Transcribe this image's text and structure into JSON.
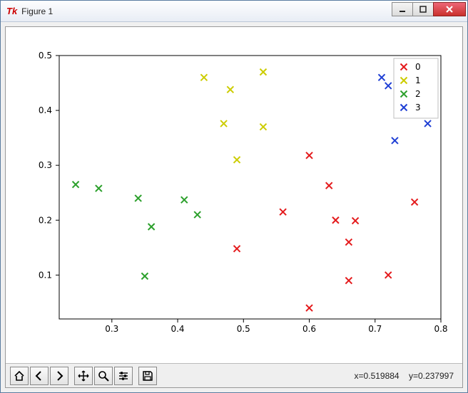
{
  "window": {
    "title": "Figure 1",
    "icon_label": "Tk"
  },
  "toolbar": {
    "home": "Home",
    "back": "Back",
    "forward": "Forward",
    "pan": "Pan",
    "zoom": "Zoom",
    "configure": "Configure subplots",
    "save": "Save"
  },
  "status": {
    "coord_text": "x=0.519884    y=0.237997"
  },
  "legend": {
    "title": "",
    "items": [
      {
        "label": "0",
        "color": "#e41a1c"
      },
      {
        "label": "1",
        "color": "#cccc00"
      },
      {
        "label": "2",
        "color": "#2ca02c"
      },
      {
        "label": "3",
        "color": "#1f3fd4"
      }
    ]
  },
  "chart_data": {
    "type": "scatter",
    "xlabel": "",
    "ylabel": "",
    "title": "",
    "xlim": [
      0.22,
      0.8
    ],
    "ylim": [
      0.02,
      0.5
    ],
    "xticks": [
      0.3,
      0.4,
      0.5,
      0.6,
      0.7,
      0.8
    ],
    "yticks": [
      0.1,
      0.2,
      0.3,
      0.4,
      0.5
    ],
    "marker": "x",
    "series": [
      {
        "name": "0",
        "color": "#e41a1c",
        "x": [
          0.49,
          0.56,
          0.6,
          0.6,
          0.63,
          0.64,
          0.66,
          0.66,
          0.67,
          0.72,
          0.76
        ],
        "y": [
          0.148,
          0.215,
          0.04,
          0.318,
          0.263,
          0.2,
          0.16,
          0.09,
          0.199,
          0.1,
          0.233
        ]
      },
      {
        "name": "1",
        "color": "#cccc00",
        "x": [
          0.44,
          0.47,
          0.48,
          0.49,
          0.53,
          0.53
        ],
        "y": [
          0.46,
          0.376,
          0.438,
          0.31,
          0.37,
          0.47
        ]
      },
      {
        "name": "2",
        "color": "#2ca02c",
        "x": [
          0.245,
          0.28,
          0.34,
          0.35,
          0.36,
          0.41,
          0.43
        ],
        "y": [
          0.265,
          0.258,
          0.24,
          0.098,
          0.188,
          0.237,
          0.21
        ]
      },
      {
        "name": "3",
        "color": "#1f3fd4",
        "x": [
          0.71,
          0.72,
          0.73,
          0.78
        ],
        "y": [
          0.46,
          0.445,
          0.345,
          0.376
        ]
      }
    ]
  }
}
